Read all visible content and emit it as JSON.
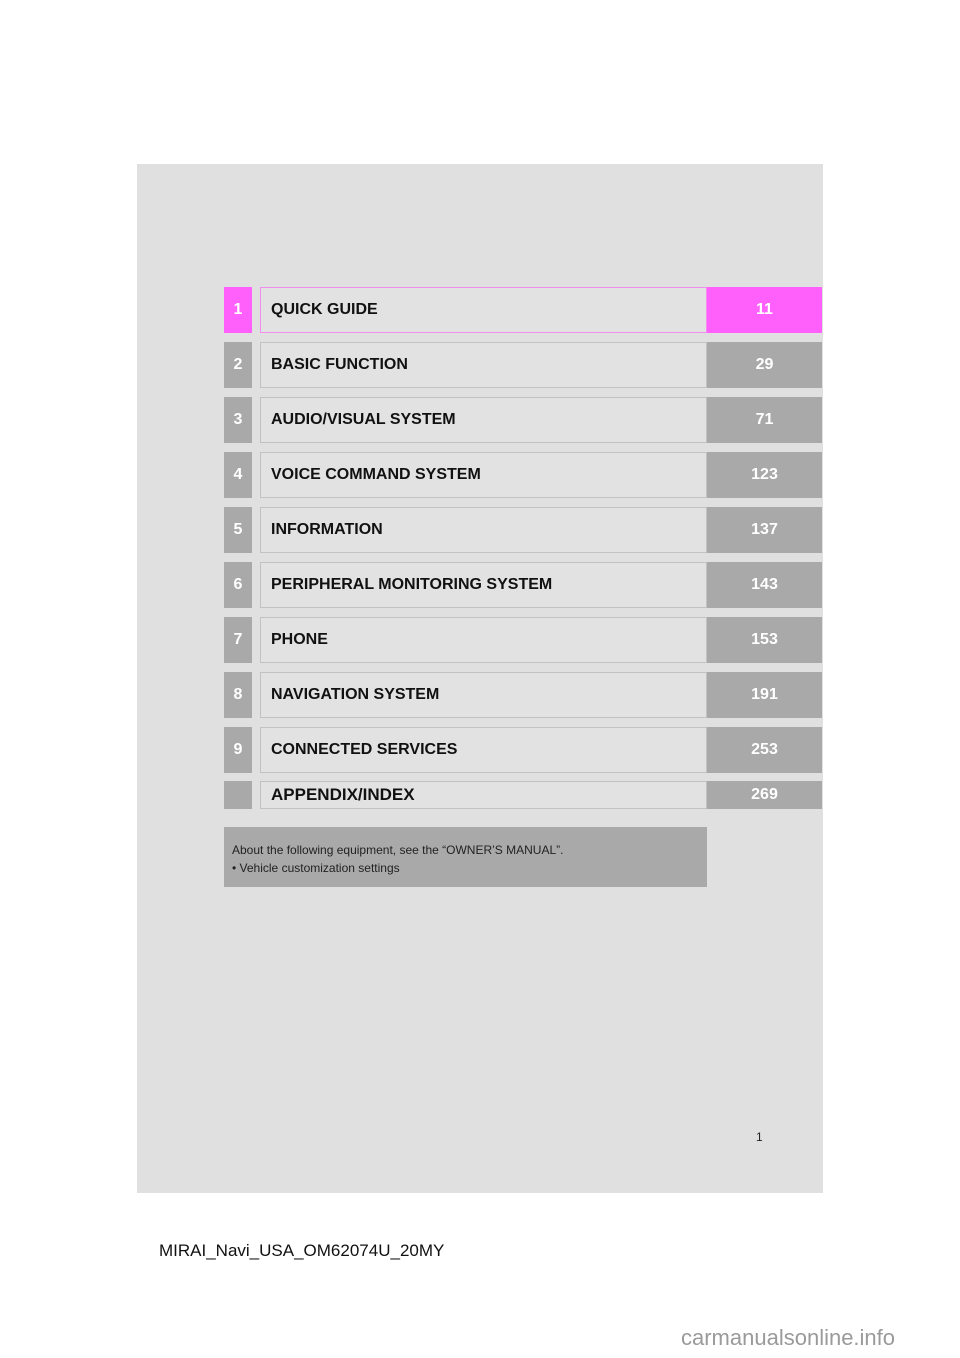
{
  "toc": {
    "active_accent": "#ff5ffb",
    "items": [
      {
        "number": "1",
        "title": "QUICK GUIDE",
        "page": "11"
      },
      {
        "number": "2",
        "title": "BASIC FUNCTION",
        "page": "29"
      },
      {
        "number": "3",
        "title": "AUDIO/VISUAL SYSTEM",
        "page": "71"
      },
      {
        "number": "4",
        "title": "VOICE COMMAND SYSTEM",
        "page": "123"
      },
      {
        "number": "5",
        "title": "INFORMATION",
        "page": "137"
      },
      {
        "number": "6",
        "title": "PERIPHERAL MONITORING SYSTEM",
        "page": "143"
      },
      {
        "number": "7",
        "title": "PHONE",
        "page": "153"
      },
      {
        "number": "8",
        "title": "NAVIGATION SYSTEM",
        "page": "191"
      },
      {
        "number": "9",
        "title": "CONNECTED SERVICES",
        "page": "253"
      },
      {
        "number": "",
        "title": "APPENDIX/INDEX",
        "page": "269"
      }
    ]
  },
  "note": {
    "line1": "About the following equipment, see the “OWNER’S MANUAL”.",
    "line2": "• Vehicle customization settings"
  },
  "page_number": "1",
  "doc_id": "MIRAI_Navi_USA_OM62074U_20MY",
  "watermark": "carmanualsonline.info"
}
